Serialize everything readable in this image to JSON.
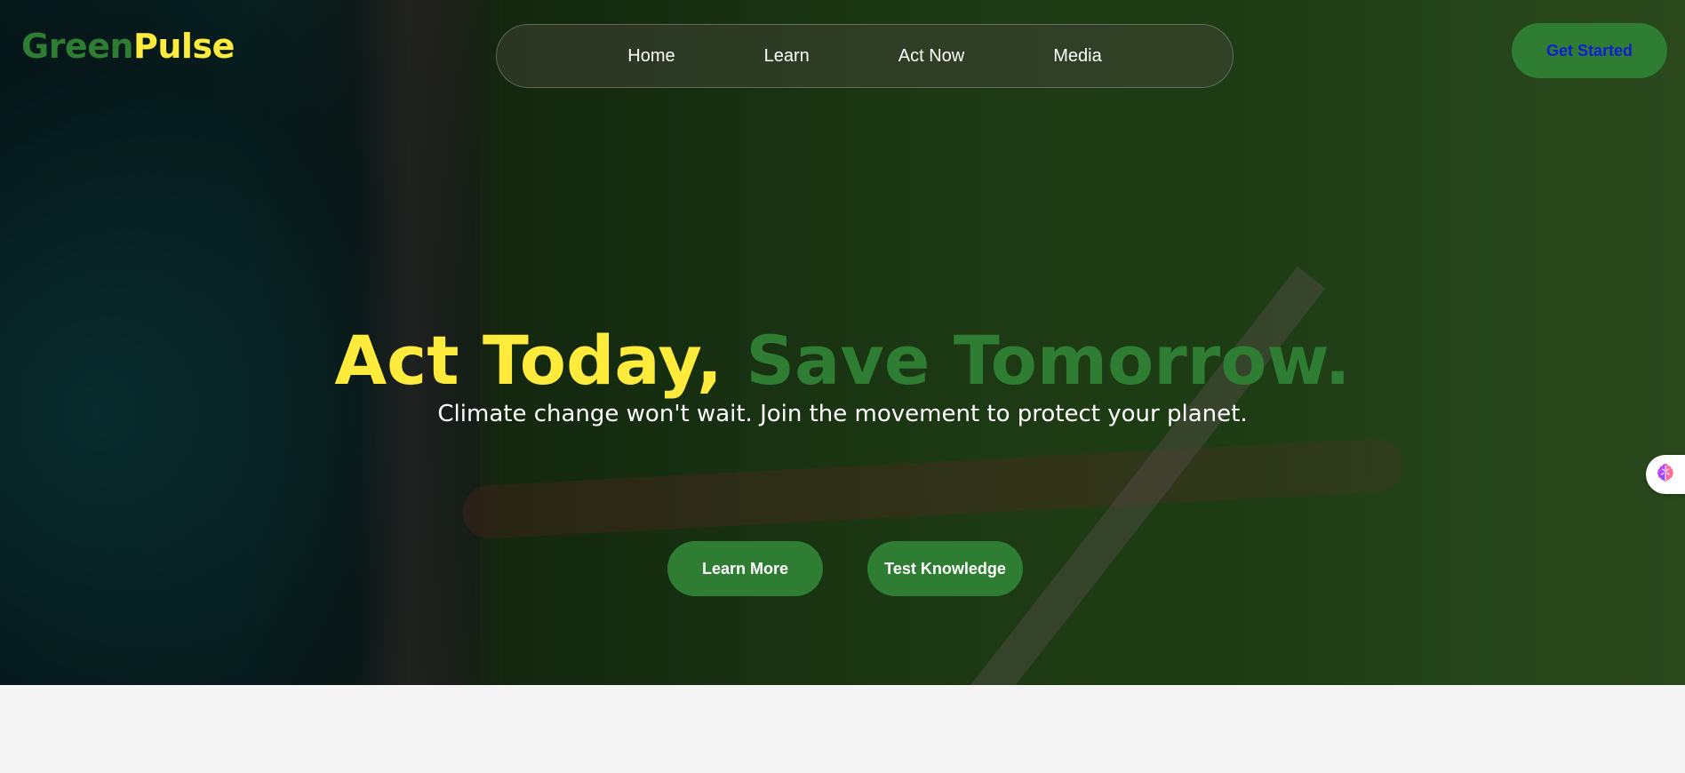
{
  "brand": {
    "part1": "Green",
    "part2": "Pulse"
  },
  "nav": {
    "items": [
      {
        "label": "Home"
      },
      {
        "label": "Learn"
      },
      {
        "label": "Act Now"
      },
      {
        "label": "Media"
      }
    ]
  },
  "header_cta": {
    "label": "Get Started"
  },
  "hero": {
    "headline_part1": "Act Today, ",
    "headline_part2": "Save Tomorrow.",
    "subtitle": "Climate change won't wait. Join the movement to protect your planet.",
    "primary_button": "Learn More",
    "secondary_button": "Test Knowledge"
  },
  "side_widget": {
    "icon": "brain-icon"
  },
  "colors": {
    "brand_green": "#2e7d32",
    "brand_yellow": "#ffeb3b",
    "cta_text_blue": "#0d1fd1",
    "page_background": "#f5f5f5"
  }
}
